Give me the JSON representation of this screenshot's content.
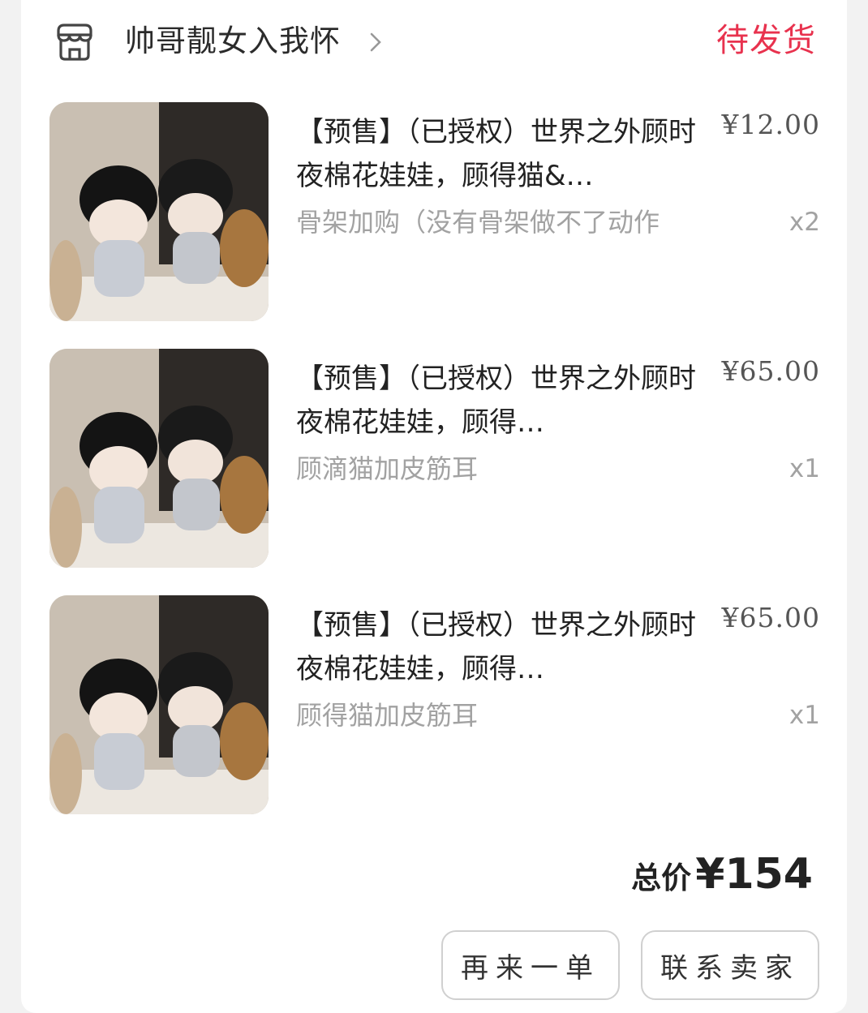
{
  "shop": {
    "name": "帅哥靓女入我怀",
    "icon": "shop-icon",
    "chevron_icon": "chevron-right-icon"
  },
  "order": {
    "status": "待发货"
  },
  "items": [
    {
      "title": "【预售】（已授权）世界之外顾时夜棉花娃娃，顾得猫&…",
      "price": "¥12.00",
      "variant": "骨架加购（没有骨架做不了动作",
      "qty": "x2",
      "image": "plush-dolls-thumbnail"
    },
    {
      "title": "【预售】（已授权）世界之外顾时夜棉花娃娃，顾得…",
      "price": "¥65.00",
      "variant": "顾滴猫加皮筋耳",
      "qty": "x1",
      "image": "plush-dolls-thumbnail"
    },
    {
      "title": "【预售】（已授权）世界之外顾时夜棉花娃娃，顾得…",
      "price": "¥65.00",
      "variant": "顾得猫加皮筋耳",
      "qty": "x1",
      "image": "plush-dolls-thumbnail"
    }
  ],
  "total": {
    "label": "总价",
    "amount": "¥154"
  },
  "actions": {
    "reorder_label": "再来一单",
    "contact_label": "联系卖家"
  },
  "colors": {
    "status": "#e8324e",
    "text": "#222222",
    "muted": "#a2a2a2",
    "border": "#d0d0d0"
  }
}
